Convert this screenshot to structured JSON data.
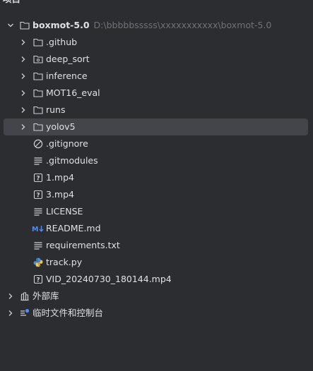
{
  "panel": {
    "title": "项目"
  },
  "root": {
    "name": "boxmot-5.0",
    "path": "D:\\bbbbbsssss\\xxxxxxxxxxx\\boxmot-5.0"
  },
  "items": [
    {
      "label": ".github",
      "icon": "folder-icon"
    },
    {
      "label": "deep_sort",
      "icon": "module-folder-icon"
    },
    {
      "label": "inference",
      "icon": "folder-icon"
    },
    {
      "label": "MOT16_eval",
      "icon": "folder-icon"
    },
    {
      "label": "runs",
      "icon": "folder-icon"
    },
    {
      "label": "yolov5",
      "icon": "folder-icon"
    },
    {
      "label": ".gitignore",
      "icon": "ignored-file-icon"
    },
    {
      "label": ".gitmodules",
      "icon": "text-file-icon"
    },
    {
      "label": "1.mp4",
      "icon": "unknown-file-icon"
    },
    {
      "label": "3.mp4",
      "icon": "unknown-file-icon"
    },
    {
      "label": "LICENSE",
      "icon": "text-file-icon"
    },
    {
      "label": "README.md",
      "icon": "markdown-file-icon"
    },
    {
      "label": "requirements.txt",
      "icon": "text-file-icon"
    },
    {
      "label": "track.py",
      "icon": "python-file-icon"
    },
    {
      "label": "VID_20240730_180144.mp4",
      "icon": "unknown-file-icon"
    }
  ],
  "external": {
    "label": "外部库"
  },
  "scratches": {
    "label": "临时文件和控制台"
  },
  "colors": {
    "background": "#2b2d30",
    "selection": "#43454a",
    "text": "#dfe1e5",
    "path": "#6f737a",
    "icon": "#ced0d6",
    "markdown_blue": "#548af7"
  }
}
